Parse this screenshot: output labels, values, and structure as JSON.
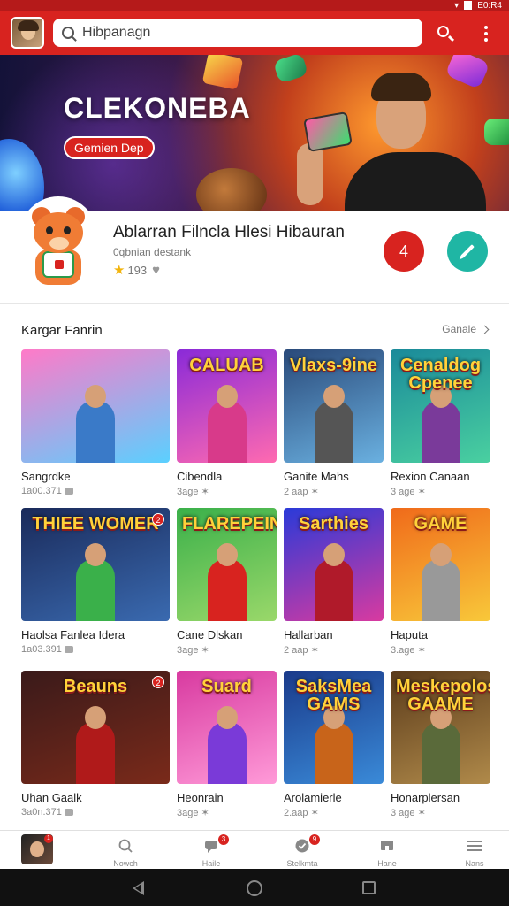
{
  "status_bar": {
    "time": "E0:R4"
  },
  "top_bar": {
    "search_value": "Hibpanagn"
  },
  "banner": {
    "title": "CLEKONEBA",
    "button_label": "Gemien Dep"
  },
  "profile": {
    "name": "Ablarran Filncla Hlesi Hibauran",
    "subtitle": "0qbnian destank",
    "rating": "193",
    "notification_count": "4"
  },
  "section": {
    "title": "Kargar Fanrin",
    "more_label": "Ganale",
    "items": [
      {
        "title": "Sangrdke",
        "meta": "1a00.371",
        "thumb_text": "",
        "colors": [
          "#ff7ac8",
          "#5ad0ff"
        ],
        "fig": "#3a7ac8"
      },
      {
        "title": "Cibendla",
        "meta": "3age ✶",
        "thumb_text": "CALUAB",
        "colors": [
          "#8a2ad8",
          "#ff6ab0"
        ],
        "fig": "#d83a8a"
      },
      {
        "title": "Ganite Mahs",
        "meta": "2 aap ✶",
        "thumb_text": "Vlaxs-9ine",
        "colors": [
          "#2a4a7a",
          "#6ab0e0"
        ],
        "fig": "#555"
      },
      {
        "title": "Rexion Canaan",
        "meta": "3 age ✶",
        "thumb_text": "Cenaldog Cpenee",
        "colors": [
          "#1a8a9a",
          "#4ad0a0"
        ],
        "fig": "#7a3a9a"
      },
      {
        "title": "Haolsa Fanlea Idera",
        "meta": "1a03.391",
        "thumb_text": "THIEE WOMER",
        "colors": [
          "#1a2a5a",
          "#3a6ab0"
        ],
        "fig": "#3ab04a",
        "badge": "2"
      },
      {
        "title": "Cane Dlskan",
        "meta": "3age ✶",
        "thumb_text": "FLAREPEIN",
        "colors": [
          "#3ab04a",
          "#9ad86a"
        ],
        "fig": "#d8231f"
      },
      {
        "title": "Hallarban",
        "meta": "2 aap ✶",
        "thumb_text": "Sarthies",
        "colors": [
          "#2a3ad8",
          "#d83aa0"
        ],
        "fig": "#b01a2a"
      },
      {
        "title": "Haputa",
        "meta": "3.age ✶",
        "thumb_text": "GAME",
        "colors": [
          "#f06a1a",
          "#f8c83a"
        ],
        "fig": "#999"
      },
      {
        "title": "Uhan Gaalk",
        "meta": "3a0n.371",
        "thumb_text": "Beauns",
        "colors": [
          "#3a1a1a",
          "#7a2a1a"
        ],
        "fig": "#b01a1a",
        "badge": "2"
      },
      {
        "title": "Heonrain",
        "meta": "3age ✶",
        "thumb_text": "Suard",
        "colors": [
          "#d83aa0",
          "#ff9ad8"
        ],
        "fig": "#7a3ad8"
      },
      {
        "title": "Arolamierle",
        "meta": "2.aap ✶",
        "thumb_text": "SaksMea GAMS",
        "colors": [
          "#1a3a8a",
          "#3a8ad8"
        ],
        "fig": "#c8641a"
      },
      {
        "title": "Honarplersan",
        "meta": "3 age ✶",
        "thumb_text": "Meskepolos GAAME",
        "colors": [
          "#5a3a1a",
          "#b08a4a"
        ],
        "fig": "#5a6a3a"
      }
    ]
  },
  "bottom_nav": {
    "avatar_badge": "1",
    "items": [
      {
        "label": "Nowch",
        "badge": ""
      },
      {
        "label": "Haile",
        "badge": "3"
      },
      {
        "label": "Stelkmta",
        "badge": "9"
      },
      {
        "label": "Hane",
        "badge": ""
      },
      {
        "label": "Nans",
        "badge": ""
      }
    ]
  }
}
